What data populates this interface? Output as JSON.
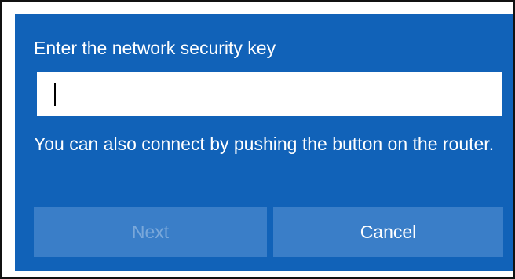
{
  "dialog": {
    "prompt": "Enter the network security key",
    "key_input": {
      "value": "",
      "placeholder": ""
    },
    "hint": "You can also connect by pushing the button on the router.",
    "buttons": {
      "next_label": "Next",
      "next_enabled": false,
      "cancel_label": "Cancel"
    }
  },
  "colors": {
    "panel_background": "#1162b8",
    "button_background": "#3a7ec8",
    "disabled_text": "#7aa8da",
    "text": "#ffffff"
  }
}
